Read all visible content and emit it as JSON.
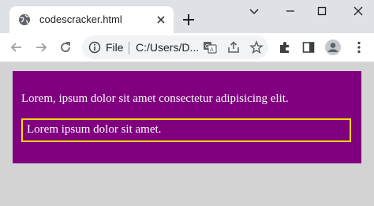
{
  "tab": {
    "title": "codescracker.html",
    "favicon": "globe-icon",
    "close_icon": "close-icon",
    "new_tab_icon": "plus-icon"
  },
  "window_controls": [
    "chevron-down-icon",
    "minimize-icon",
    "maximize-icon",
    "close-icon"
  ],
  "toolbar": {
    "back_icon": "arrow-left-icon",
    "forward_icon": "arrow-right-icon",
    "reload_icon": "reload-icon",
    "site_info_icon": "info-icon",
    "site_label": "File",
    "url": "C:/Users/D...",
    "translate_icon": "translate-icon",
    "share_icon": "share-icon",
    "bookmark_icon": "star-icon",
    "extensions_icon": "puzzle-icon",
    "side_panel_icon": "side-panel-icon",
    "profile_icon": "avatar-icon",
    "menu_icon": "kebab-menu-icon"
  },
  "page": {
    "paragraph1": "Lorem, ipsum dolor sit amet consectetur adipisicing elit.",
    "paragraph2": "Lorem ipsum dolor sit amet."
  },
  "colors": {
    "page_bg": "#d3d3d3",
    "box_bg": "#800080",
    "inner_border": "#ffd700",
    "text": "#ffffff"
  }
}
